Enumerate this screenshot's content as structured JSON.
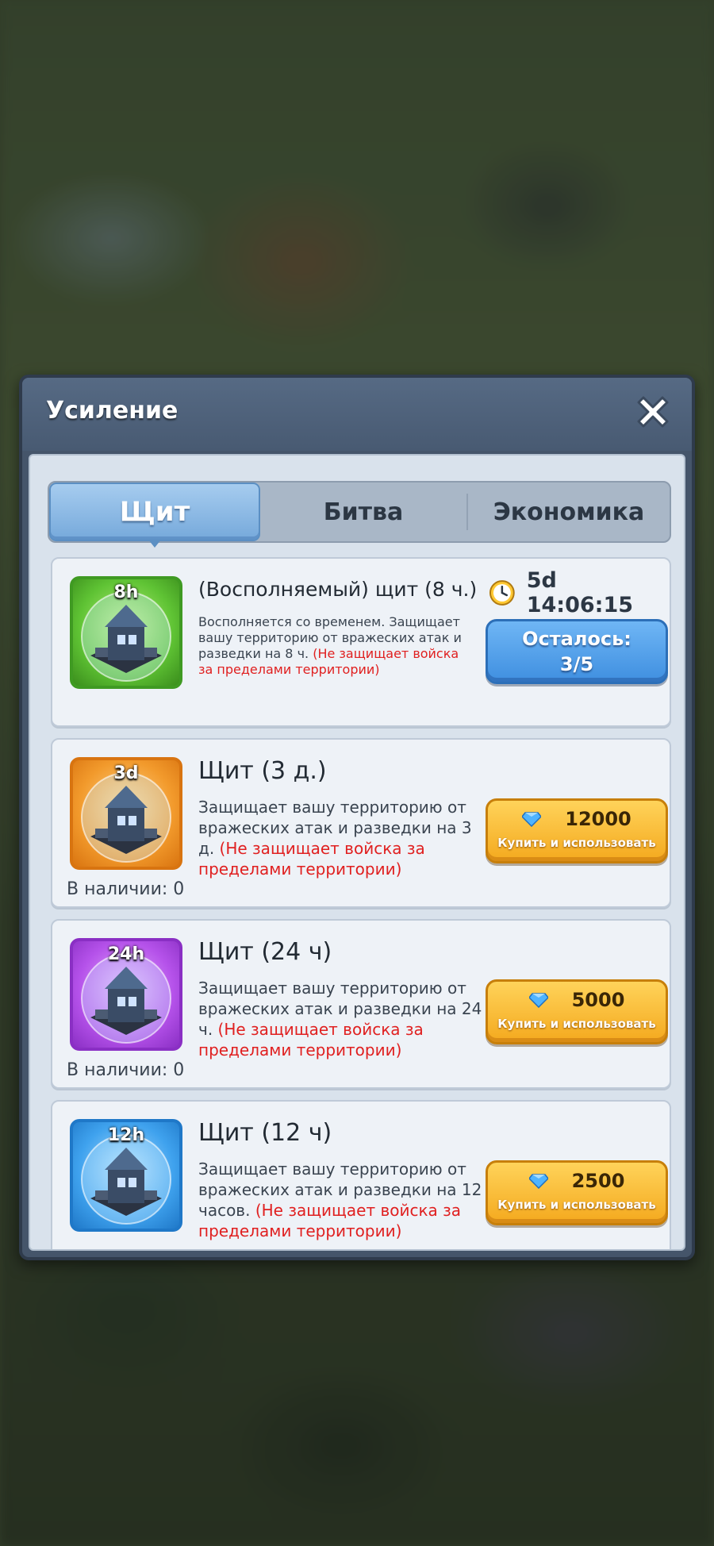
{
  "dialog": {
    "title": "Усиление",
    "close_icon": "close-x-icon"
  },
  "tabs": [
    {
      "label": "Щит",
      "active": true
    },
    {
      "label": "Битва",
      "active": false
    },
    {
      "label": "Экономика",
      "active": false
    }
  ],
  "items": [
    {
      "badge": "8h",
      "title": "(Восполняемый) щит (8 ч.)",
      "desc": "Восполняется со временем. Защищает вашу территорию от вражеских атак и разведки на 8 ч.",
      "warning": "(Не защищает войска за пределами территории)",
      "timer": "5d 14:06:15",
      "button_line1": "Осталось:",
      "button_line2": "3/5",
      "frame_color": "#4fbf2e"
    },
    {
      "badge": "3d",
      "title": "Щит (3 д.)",
      "desc": "Защищает вашу территорию от вражеских атак и разведки на 3 д.",
      "warning": "(Не защищает войска за пределами территории)",
      "price": "12000",
      "button_caption": "Купить и использовать",
      "stock": "В наличии: 0",
      "frame_color": "#f08a1c"
    },
    {
      "badge": "24h",
      "title": "Щит (24 ч)",
      "desc": "Защищает вашу территорию от вражеских атак и разведки на 24 ч.",
      "warning": "(Не защищает войска за пределами территории)",
      "price": "5000",
      "button_caption": "Купить и использовать",
      "stock": "В наличии: 0",
      "frame_color": "#b14be6"
    },
    {
      "badge": "12h",
      "title": "Щит (12 ч)",
      "desc": "Защищает вашу территорию от вражеских атак и разведки на 12 часов.",
      "warning": "(Не защищает войска за пределами территории)",
      "price": "2500",
      "button_caption": "Купить и использовать",
      "frame_color": "#2f95e8"
    }
  ],
  "colors": {
    "warning_text": "#e02020",
    "gold_button": "#f4a91e",
    "blue_button": "#3f8fe0"
  }
}
